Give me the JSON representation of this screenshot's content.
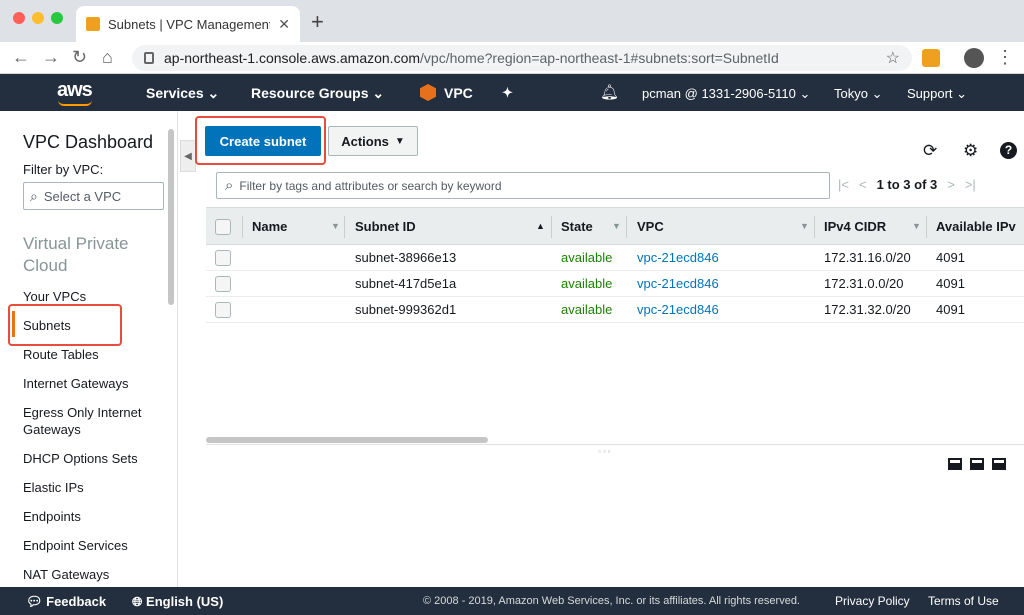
{
  "browser": {
    "tab_title": "Subnets | VPC Management Co",
    "new_tab": "+",
    "url_host": "ap-northeast-1.console.aws.amazon.com",
    "url_path": "/vpc/home?region=ap-northeast-1#subnets:sort=SubnetId"
  },
  "topnav": {
    "logo": "aws",
    "services": "Services",
    "resource_groups": "Resource Groups",
    "vpc": "VPC",
    "account": "pcman @ 1331-2906-5110",
    "region": "Tokyo",
    "support": "Support"
  },
  "sidebar": {
    "dashboard": "VPC Dashboard",
    "filter_label": "Filter by VPC:",
    "select_placeholder": "Select a VPC",
    "section": "Virtual Private Cloud",
    "items": [
      "Your VPCs",
      "Subnets",
      "Route Tables",
      "Internet Gateways",
      "Egress Only Internet Gateways",
      "DHCP Options Sets",
      "Elastic IPs",
      "Endpoints",
      "Endpoint Services",
      "NAT Gateways"
    ],
    "active_item": "Subnets"
  },
  "toolbar": {
    "create_label": "Create subnet",
    "actions_label": "Actions"
  },
  "filter": {
    "placeholder": "Filter by tags and attributes or search by keyword"
  },
  "pager": {
    "count": "1 to 3 of 3"
  },
  "table": {
    "columns": [
      "Name",
      "Subnet ID",
      "State",
      "VPC",
      "IPv4 CIDR",
      "Available IPv"
    ],
    "rows": [
      {
        "name": "",
        "subnet_id": "subnet-38966e13",
        "state": "available",
        "vpc": "vpc-21ecd846",
        "cidr": "172.31.16.0/20",
        "available": "4091"
      },
      {
        "name": "",
        "subnet_id": "subnet-417d5e1a",
        "state": "available",
        "vpc": "vpc-21ecd846",
        "cidr": "172.31.0.0/20",
        "available": "4091"
      },
      {
        "name": "",
        "subnet_id": "subnet-999362d1",
        "state": "available",
        "vpc": "vpc-21ecd846",
        "cidr": "172.31.32.0/20",
        "available": "4091"
      }
    ]
  },
  "footer": {
    "feedback": "Feedback",
    "language": "English (US)",
    "copyright": "© 2008 - 2019, Amazon Web Services, Inc. or its affiliates. All rights reserved.",
    "privacy": "Privacy Policy",
    "terms": "Terms of Use"
  },
  "colors": {
    "aws_nav": "#232f3e",
    "primary_button": "#0073bb",
    "highlight": "#e74c3c",
    "status_available": "#1d8102"
  }
}
